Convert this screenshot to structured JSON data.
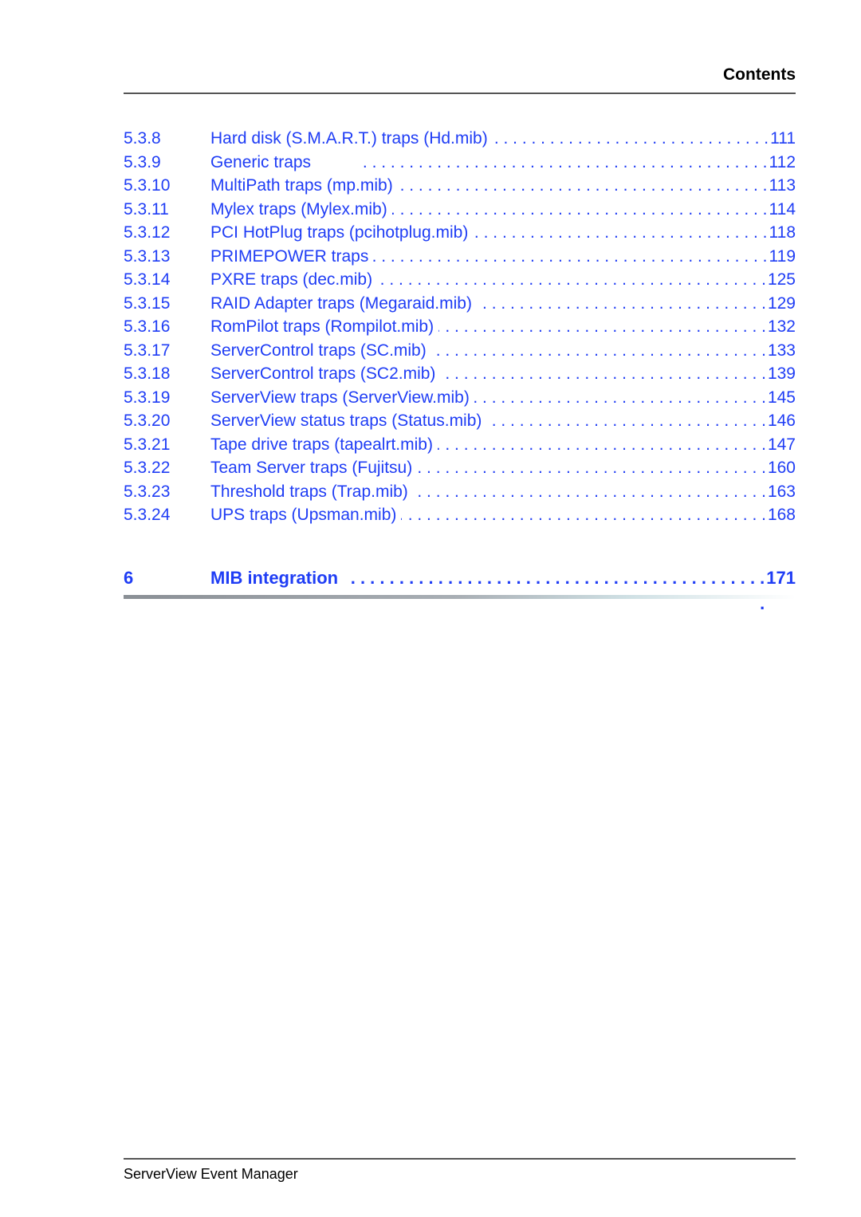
{
  "header": {
    "title": "Contents"
  },
  "toc": {
    "entries": [
      {
        "number": "5.3.8",
        "title": "Hard disk (S.M.A.R.T.) traps (Hd.mib)",
        "page": "111"
      },
      {
        "number": "5.3.9",
        "title": "Generic traps",
        "page": "112"
      },
      {
        "number": "5.3.10",
        "title": "MultiPath traps (mp.mib)",
        "page": "113"
      },
      {
        "number": "5.3.11",
        "title": "Mylex traps (Mylex.mib)",
        "page": "114"
      },
      {
        "number": "5.3.12",
        "title": "PCI HotPlug traps (pcihotplug.mib)",
        "page": "118"
      },
      {
        "number": "5.3.13",
        "title": "PRIMEPOWER traps",
        "page": "119"
      },
      {
        "number": "5.3.14",
        "title": "PXRE traps (dec.mib)",
        "page": "125"
      },
      {
        "number": "5.3.15",
        "title": "RAID Adapter traps (Megaraid.mib)",
        "page": "129"
      },
      {
        "number": "5.3.16",
        "title": "RomPilot traps (Rompilot.mib)",
        "page": "132"
      },
      {
        "number": "5.3.17",
        "title": "ServerControl traps (SC.mib)",
        "page": "133"
      },
      {
        "number": "5.3.18",
        "title": "ServerControl traps (SC2.mib)",
        "page": "139"
      },
      {
        "number": "5.3.19",
        "title": "ServerView traps (ServerView.mib)",
        "page": "145"
      },
      {
        "number": "5.3.20",
        "title": "ServerView status traps (Status.mib)",
        "page": "146"
      },
      {
        "number": "5.3.21",
        "title": "Tape drive traps (tapealrt.mib)",
        "page": "147"
      },
      {
        "number": "5.3.22",
        "title": "Team Server traps (Fujitsu)",
        "page": "160"
      },
      {
        "number": "5.3.23",
        "title": "Threshold traps (Trap.mib)",
        "page": "163"
      },
      {
        "number": "5.3.24",
        "title": "UPS traps (Upsman.mib)",
        "page": "168"
      }
    ],
    "chapter": {
      "number": "6",
      "title": "MIB integration",
      "page": "171"
    },
    "leader": ". . . . . . . . . . . . . . . . . . . . . . . . . . . . . . . . . . . . . . . . . . . ."
  },
  "footer": {
    "text": "ServerView Event Manager"
  },
  "colors": {
    "link": "#1f3df5",
    "text": "#000000"
  }
}
